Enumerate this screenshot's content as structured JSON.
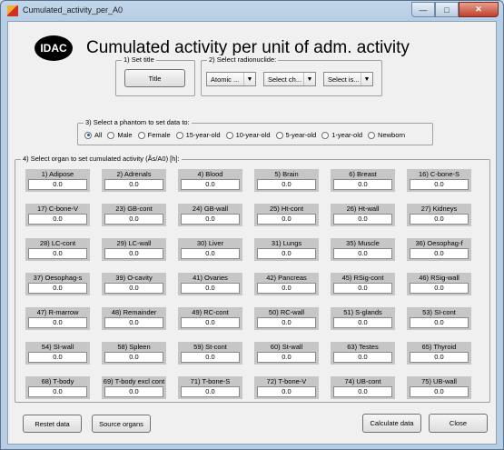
{
  "window": {
    "title": "Cumulated_activity_per_A0"
  },
  "header": {
    "logo": "IDAC",
    "title": "Cumulated activity per unit of adm. activity"
  },
  "set_title": {
    "label": "1) Set title",
    "button": "Title"
  },
  "radionuclide": {
    "label": "2) Select radionuclide:",
    "combos": [
      "Atomic ...",
      "Select ch...",
      "Select is..."
    ]
  },
  "phantom": {
    "label": "3) Select a phantom to set data to:",
    "options": [
      "All",
      "Male",
      "Female",
      "15-year-old",
      "10-year-old",
      "5-year-old",
      "1-year-old",
      "Newborn"
    ],
    "selected": "All"
  },
  "organs": {
    "label": "4) Select organ to set cumulated activity (Ãs/A0) [h]:",
    "items": [
      {
        "label": "1) Adipose",
        "value": "0.0"
      },
      {
        "label": "2) Adrenals",
        "value": "0.0"
      },
      {
        "label": "4) Blood",
        "value": "0.0"
      },
      {
        "label": "5) Brain",
        "value": "0.0"
      },
      {
        "label": "6) Breast",
        "value": "0.0"
      },
      {
        "label": "16) C-bone-S",
        "value": "0.0"
      },
      {
        "label": "17) C-bone-V",
        "value": "0.0"
      },
      {
        "label": "23) GB-cont",
        "value": "0.0"
      },
      {
        "label": "24) GB-wall",
        "value": "0.0"
      },
      {
        "label": "25) Ht-cont",
        "value": "0.0"
      },
      {
        "label": "26) Ht-wall",
        "value": "0.0"
      },
      {
        "label": "27) Kidneys",
        "value": "0.0"
      },
      {
        "label": "28) LC-cont",
        "value": "0.0"
      },
      {
        "label": "29) LC-wall",
        "value": "0.0"
      },
      {
        "label": "30) Liver",
        "value": "0.0"
      },
      {
        "label": "31) Lungs",
        "value": "0.0"
      },
      {
        "label": "35) Muscle",
        "value": "0.0"
      },
      {
        "label": "36) Oesophag-f",
        "value": "0.0"
      },
      {
        "label": "37) Oesophag-s",
        "value": "0.0"
      },
      {
        "label": "39) O-cavity",
        "value": "0.0"
      },
      {
        "label": "41) Ovaries",
        "value": "0.0"
      },
      {
        "label": "42) Pancreas",
        "value": "0.0"
      },
      {
        "label": "45) RSig-cont",
        "value": "0.0"
      },
      {
        "label": "46) RSig-wall",
        "value": "0.0"
      },
      {
        "label": "47) R-marrow",
        "value": "0.0"
      },
      {
        "label": "48) Remainder",
        "value": "0.0"
      },
      {
        "label": "49) RC-cont",
        "value": "0.0"
      },
      {
        "label": "50) RC-wall",
        "value": "0.0"
      },
      {
        "label": "51) S-glands",
        "value": "0.0"
      },
      {
        "label": "53) SI-cont",
        "value": "0.0"
      },
      {
        "label": "54) SI-wall",
        "value": "0.0"
      },
      {
        "label": "58) Spleen",
        "value": "0.0"
      },
      {
        "label": "59) St-cont",
        "value": "0.0"
      },
      {
        "label": "60) St-wall",
        "value": "0.0"
      },
      {
        "label": "63) Testes",
        "value": "0.0"
      },
      {
        "label": "65) Thyroid",
        "value": "0.0"
      },
      {
        "label": "68) T-body",
        "value": "0.0"
      },
      {
        "label": "69) T-body excl cont",
        "value": "0.0"
      },
      {
        "label": "71) T-bone-S",
        "value": "0.0"
      },
      {
        "label": "72) T-bone-V",
        "value": "0.0"
      },
      {
        "label": "74) UB-cont",
        "value": "0.0"
      },
      {
        "label": "75) UB-wall",
        "value": "0.0"
      }
    ]
  },
  "buttons": {
    "reset": "Restet data",
    "source": "Source organs",
    "calculate": "Calculate data",
    "close": "Close"
  }
}
